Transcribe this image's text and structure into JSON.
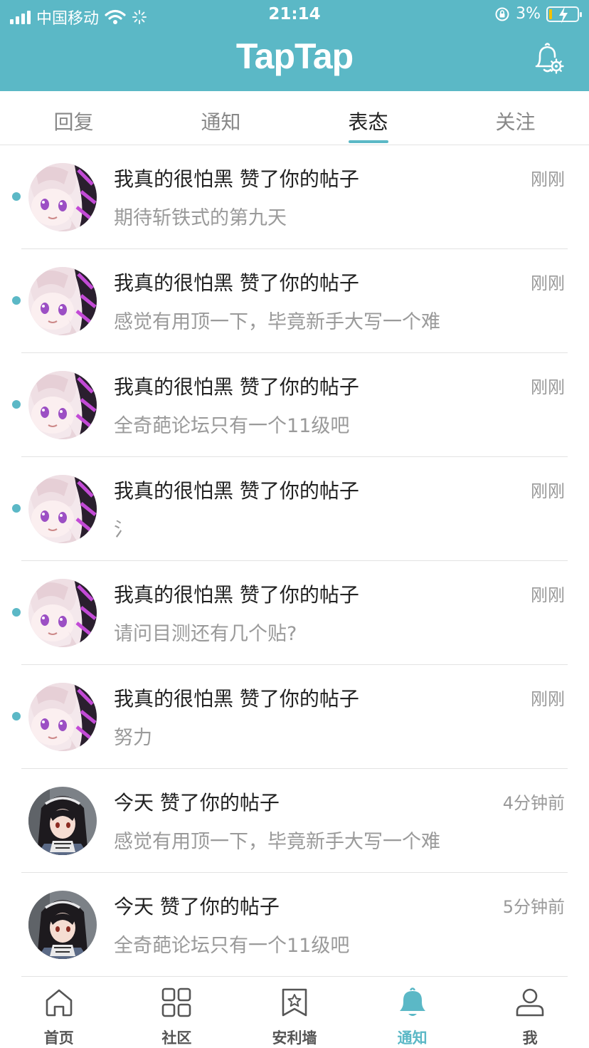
{
  "status_bar": {
    "carrier": "中国移动",
    "time": "21:14",
    "battery": "3%",
    "battery_level": 0.03
  },
  "header": {
    "logo": "TapTap",
    "icon": "bell-settings-icon"
  },
  "tabs": [
    {
      "label": "回复",
      "active": false
    },
    {
      "label": "通知",
      "active": false
    },
    {
      "label": "表态",
      "active": true
    },
    {
      "label": "关注",
      "active": false
    }
  ],
  "notifications": [
    {
      "title": "我真的很怕黑 赞了你的帖子",
      "time": "刚刚",
      "preview": "期待斩铁式的第九天",
      "unread": true,
      "avatar": "pink-hair-anime-avatar"
    },
    {
      "title": "我真的很怕黑 赞了你的帖子",
      "time": "刚刚",
      "preview": "感觉有用顶一下，毕竟新手大写一个难",
      "unread": true,
      "avatar": "pink-hair-anime-avatar"
    },
    {
      "title": "我真的很怕黑 赞了你的帖子",
      "time": "刚刚",
      "preview": "全奇葩论坛只有一个11级吧",
      "unread": true,
      "avatar": "pink-hair-anime-avatar"
    },
    {
      "title": "我真的很怕黑 赞了你的帖子",
      "time": "刚刚",
      "preview": "氵",
      "unread": true,
      "avatar": "pink-hair-anime-avatar"
    },
    {
      "title": "我真的很怕黑 赞了你的帖子",
      "time": "刚刚",
      "preview": "请问目测还有几个贴?",
      "unread": true,
      "avatar": "pink-hair-anime-avatar"
    },
    {
      "title": "我真的很怕黑 赞了你的帖子",
      "time": "刚刚",
      "preview": "努力",
      "unread": true,
      "avatar": "pink-hair-anime-avatar"
    },
    {
      "title": "今天 赞了你的帖子",
      "time": "4分钟前",
      "preview": "感觉有用顶一下，毕竟新手大写一个难",
      "unread": false,
      "avatar": "dark-hair-anime-avatar"
    },
    {
      "title": "今天 赞了你的帖子",
      "time": "5分钟前",
      "preview": "全奇葩论坛只有一个11级吧",
      "unread": false,
      "avatar": "dark-hair-anime-avatar"
    }
  ],
  "bottom_nav": [
    {
      "label": "首页",
      "icon": "home-icon",
      "active": false
    },
    {
      "label": "社区",
      "icon": "grid-icon",
      "active": false
    },
    {
      "label": "安利墙",
      "icon": "star-bookmark-icon",
      "active": false
    },
    {
      "label": "通知",
      "icon": "bell-icon",
      "active": true
    },
    {
      "label": "我",
      "icon": "user-icon",
      "active": false
    }
  ],
  "colors": {
    "accent": "#5bb8c6",
    "text": "#222222",
    "muted": "#999999"
  }
}
